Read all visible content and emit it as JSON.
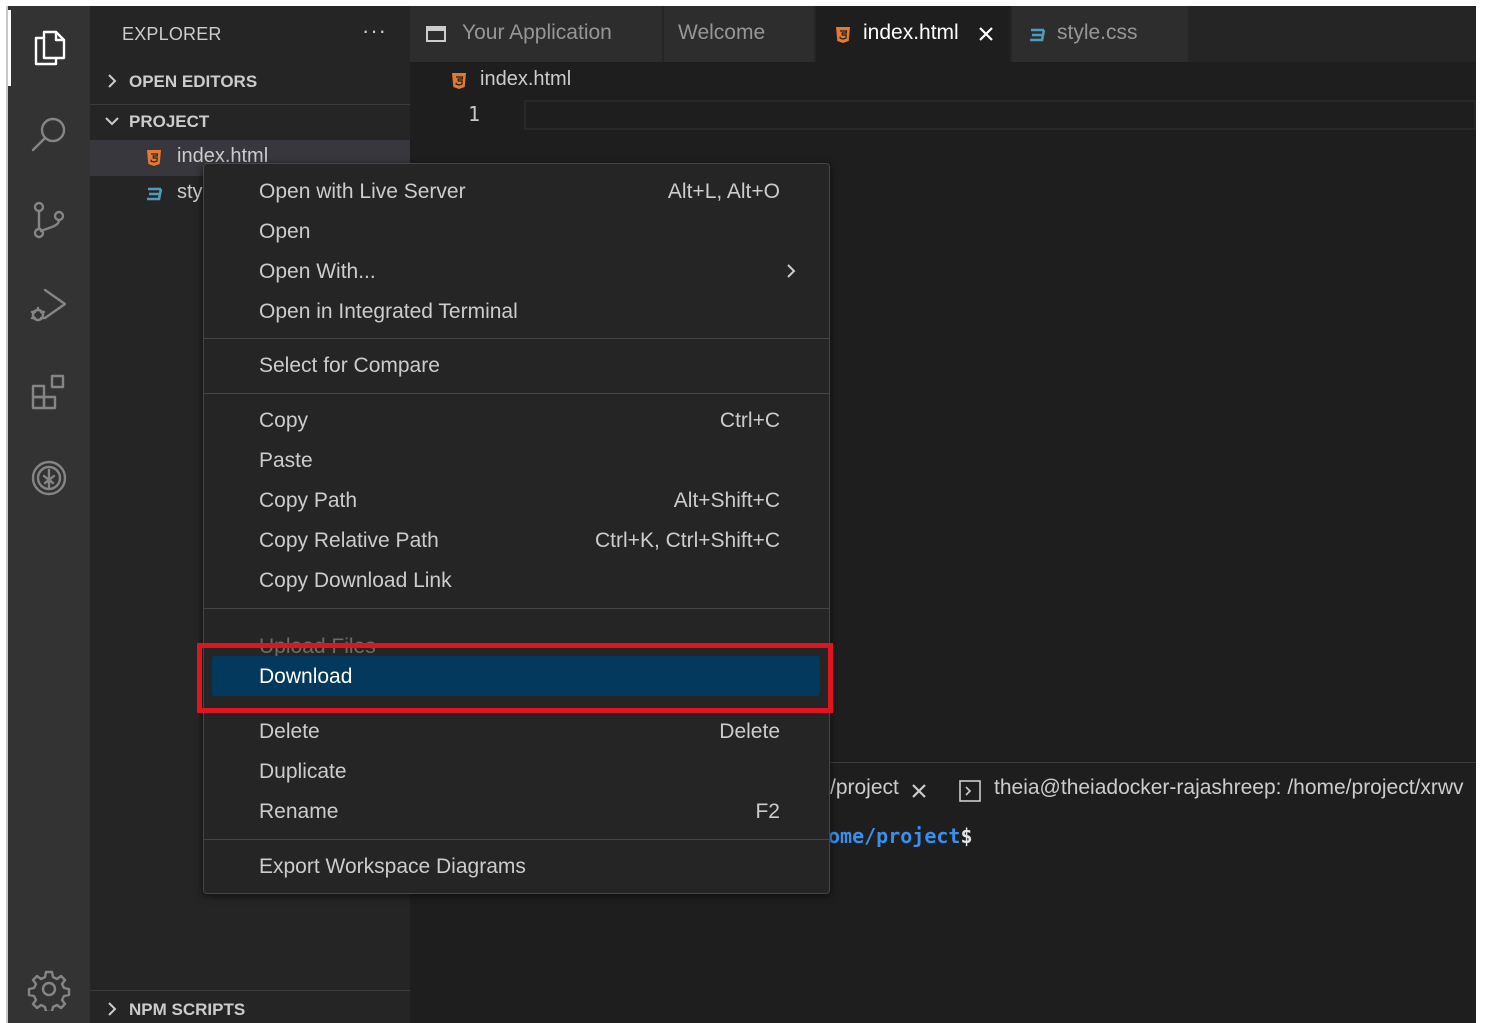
{
  "sidebar": {
    "title": "EXPLORER",
    "more": "···",
    "open_editors": "OPEN EDITORS",
    "project": "PROJECT",
    "files": [
      "index.html",
      "sty"
    ],
    "npm_scripts": "NPM SCRIPTS"
  },
  "tabs": [
    {
      "label": "Your Application",
      "active": false
    },
    {
      "label": "Welcome",
      "active": false
    },
    {
      "label": "index.html",
      "active": true
    },
    {
      "label": "style.css",
      "active": false
    }
  ],
  "breadcrumb": "index.html",
  "editor": {
    "line_number": "1"
  },
  "terminal": {
    "tab1_label": "/project",
    "tab2_label": "theia@theiadocker-rajashreep: /home/project/xrwv",
    "prompt_path": "ome/project",
    "prompt_symbol": "$"
  },
  "context_menu": {
    "items": [
      {
        "label": "Open with Live Server",
        "shortcut": "Alt+L, Alt+O"
      },
      {
        "label": "Open",
        "shortcut": ""
      },
      {
        "label": "Open With...",
        "shortcut": ""
      },
      {
        "label": "Open in Integrated Terminal",
        "shortcut": ""
      },
      {
        "label": "Select for Compare",
        "shortcut": ""
      },
      {
        "label": "Copy",
        "shortcut": "Ctrl+C"
      },
      {
        "label": "Paste",
        "shortcut": ""
      },
      {
        "label": "Copy Path",
        "shortcut": "Alt+Shift+C"
      },
      {
        "label": "Copy Relative Path",
        "shortcut": "Ctrl+K, Ctrl+Shift+C"
      },
      {
        "label": "Copy Download Link",
        "shortcut": ""
      },
      {
        "label": "Upload Files",
        "shortcut": ""
      },
      {
        "label": "Download",
        "shortcut": ""
      },
      {
        "label": "Delete",
        "shortcut": "Delete"
      },
      {
        "label": "Duplicate",
        "shortcut": ""
      },
      {
        "label": "Rename",
        "shortcut": "F2"
      },
      {
        "label": "Export Workspace Diagrams",
        "shortcut": ""
      }
    ]
  },
  "colors": {
    "highlight": "#04395e",
    "annotation_box": "#e0141e",
    "html_icon": "#e37933",
    "css_icon": "#519aba"
  }
}
